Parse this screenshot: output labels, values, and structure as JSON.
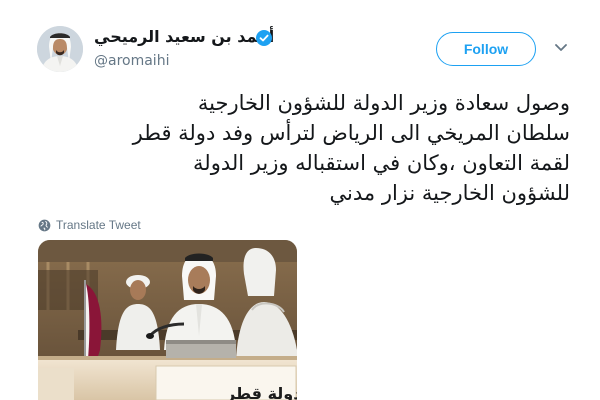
{
  "author": {
    "name": "أحمد بن سعيد الرميحي",
    "handle": "@aromaihi",
    "verified": true,
    "avatar_icon": "profile-photo"
  },
  "actions": {
    "follow_label": "Follow",
    "more_icon": "chevron-down-icon"
  },
  "tweet": {
    "lines": [
      "وصول سعادة وزير الدولة للشؤون الخارجية",
      "سلطان المريخي الى الرياض لترأس وفد دولة قطر",
      "لقمة التعاون ،وكان في استقباله وزير الدولة",
      "للشؤون الخارجية نزار مدني"
    ]
  },
  "translate": {
    "label": "Translate Tweet",
    "icon": "globe-icon"
  },
  "media": {
    "nameplate": "دولة قطر"
  },
  "colors": {
    "accent": "#1da1f2",
    "text": "#14171a",
    "secondary": "#657786"
  }
}
